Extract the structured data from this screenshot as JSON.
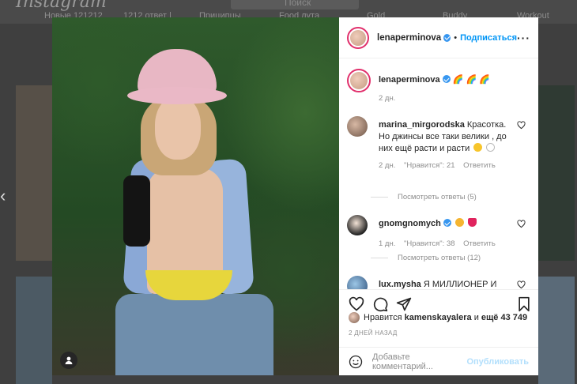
{
  "backdrop": {
    "logo": "Instagram",
    "search_placeholder": "Поиск",
    "stories": [
      "Новые 121212",
      "1212 ответ |",
      "Приципцы",
      "Food лута",
      "Gold",
      "Buddy",
      "Workout"
    ]
  },
  "post": {
    "author": "lenaperminova",
    "follow_label": "Подписаться",
    "caption_text": "🌈 🌈 🌈",
    "caption_time": "2 дн.",
    "comments": [
      {
        "user": "marina_mirgorodska",
        "text": "Красотка. Но джинсы все таки велики , до них ещё расти и расти",
        "time": "2 дн.",
        "likes": "\"Нравится\": 21",
        "reply": "Ответить",
        "view_replies": "Посмотреть ответы (5)"
      },
      {
        "user": "gnomgnomych",
        "text": "",
        "time": "1 дн.",
        "likes": "\"Нравится\": 38",
        "reply": "Ответить",
        "view_replies": "Посмотреть ответы (12)"
      },
      {
        "user": "lux.mysha",
        "text": "Я МИЛЛИОНЕР И МНЕ ПОНРАВИЛОСЬ,",
        "time": "",
        "likes": "",
        "reply": "",
        "view_replies": ""
      }
    ],
    "likes_prefix": "Нравится",
    "likes_user": "kamenskayalera",
    "likes_mid": "и",
    "likes_count": "ещё 43 749",
    "date": "2 ДНЕЙ НАЗАД",
    "add_comment_placeholder": "Добавьте комментарий...",
    "publish_label": "Опубликовать"
  },
  "colors": {
    "accent": "#0095f6",
    "verified": "#3897f0",
    "publish_disabled": "#b2dffc"
  }
}
